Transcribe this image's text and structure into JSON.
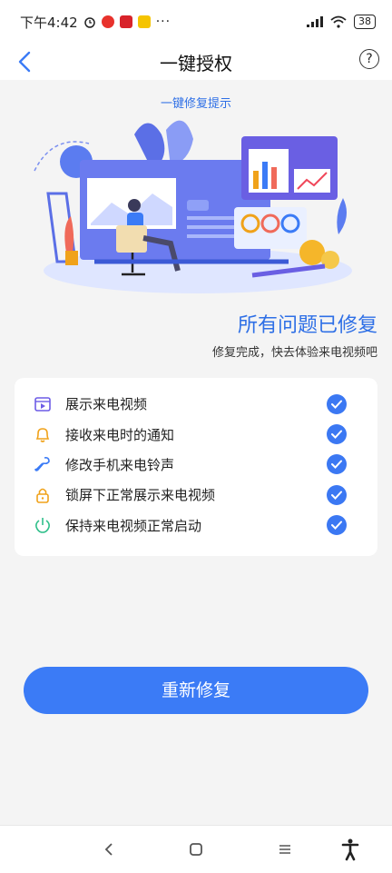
{
  "status": {
    "time": "下午4:42",
    "battery": "38"
  },
  "header": {
    "title": "一键授权",
    "help_symbol": "?"
  },
  "hint": "一键修复提示",
  "result": {
    "title": "所有问题已修复",
    "subtitle": "修复完成，快去体验来电视频吧"
  },
  "items": [
    {
      "label": "展示来电视频",
      "icon": "video-icon",
      "color": "#6d5ce6"
    },
    {
      "label": "接收来电时的通知",
      "icon": "bell-icon",
      "color": "#f0a21a"
    },
    {
      "label": "修改手机来电铃声",
      "icon": "wrench-icon",
      "color": "#3b7bf6"
    },
    {
      "label": "锁屏下正常展示来电视频",
      "icon": "lock-icon",
      "color": "#f0a21a"
    },
    {
      "label": "保持来电视频正常启动",
      "icon": "power-icon",
      "color": "#2fbf8a"
    }
  ],
  "button": "重新修复",
  "colors": {
    "accent": "#3b7bf6",
    "background": "#f4f4f4"
  }
}
